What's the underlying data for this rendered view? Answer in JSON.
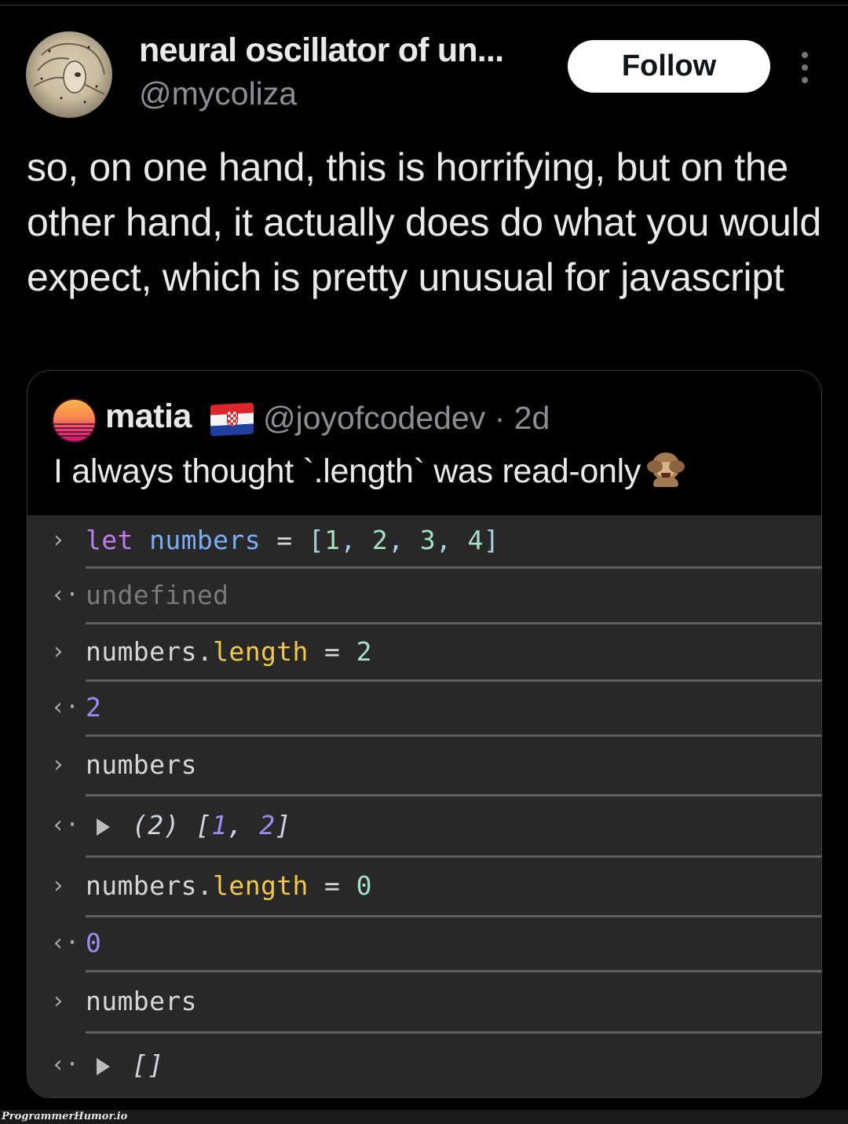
{
  "tweet": {
    "author": {
      "display_name": "neural oscillator of un...",
      "handle": "@mycoliza"
    },
    "follow_label": "Follow",
    "more_icon": "more-vertical-icon",
    "text": "so, on one hand, this is horrifying, but on the other hand, it actually does do what you would expect, which is pretty unusual for javascript"
  },
  "quoted_tweet": {
    "author": {
      "display_name": "matia",
      "flag": "croatia-flag",
      "handle_and_time": "@joyofcodedev · 2d"
    },
    "text": "I always thought `.length` was read-only",
    "emoji": "see-no-evil-monkey"
  },
  "console": {
    "prompt_input": "›",
    "prompt_output": "‹·",
    "lines": [
      {
        "kind": "input",
        "tokens": [
          [
            "let",
            "kw"
          ],
          [
            " ",
            "op"
          ],
          [
            "numbers",
            "var"
          ],
          [
            " = ",
            "op"
          ],
          [
            "[",
            "punc"
          ],
          [
            "1",
            "num"
          ],
          [
            ", ",
            "punc"
          ],
          [
            "2",
            "num"
          ],
          [
            ", ",
            "punc"
          ],
          [
            "3",
            "num"
          ],
          [
            ", ",
            "punc"
          ],
          [
            "4",
            "num"
          ],
          [
            "]",
            "punc"
          ]
        ]
      },
      {
        "kind": "output",
        "tokens": [
          [
            "undefined",
            "undef"
          ]
        ]
      },
      {
        "kind": "input",
        "tokens": [
          [
            "numbers.",
            "op"
          ],
          [
            "length",
            "prop"
          ],
          [
            " = ",
            "op"
          ],
          [
            "2",
            "num"
          ]
        ]
      },
      {
        "kind": "output",
        "tokens": [
          [
            "2",
            "res"
          ]
        ]
      },
      {
        "kind": "input",
        "tokens": [
          [
            "numbers",
            "op"
          ]
        ]
      },
      {
        "kind": "output",
        "expandable": true,
        "tokens": [
          [
            "(2) ",
            "ital"
          ],
          [
            "[",
            "ital"
          ],
          [
            "1",
            "ital-num"
          ],
          [
            ", ",
            "ital"
          ],
          [
            "2",
            "ital-num"
          ],
          [
            "]",
            "ital"
          ]
        ]
      },
      {
        "kind": "input",
        "tokens": [
          [
            "numbers.",
            "op"
          ],
          [
            "length",
            "prop"
          ],
          [
            " = ",
            "op"
          ],
          [
            "0",
            "num"
          ]
        ]
      },
      {
        "kind": "output",
        "tokens": [
          [
            "0",
            "res"
          ]
        ]
      },
      {
        "kind": "input",
        "tokens": [
          [
            "numbers",
            "op"
          ]
        ]
      },
      {
        "kind": "output",
        "expandable": true,
        "tokens": [
          [
            "[]",
            "ital"
          ]
        ]
      }
    ]
  },
  "watermark": "ProgrammerHumor.io"
}
